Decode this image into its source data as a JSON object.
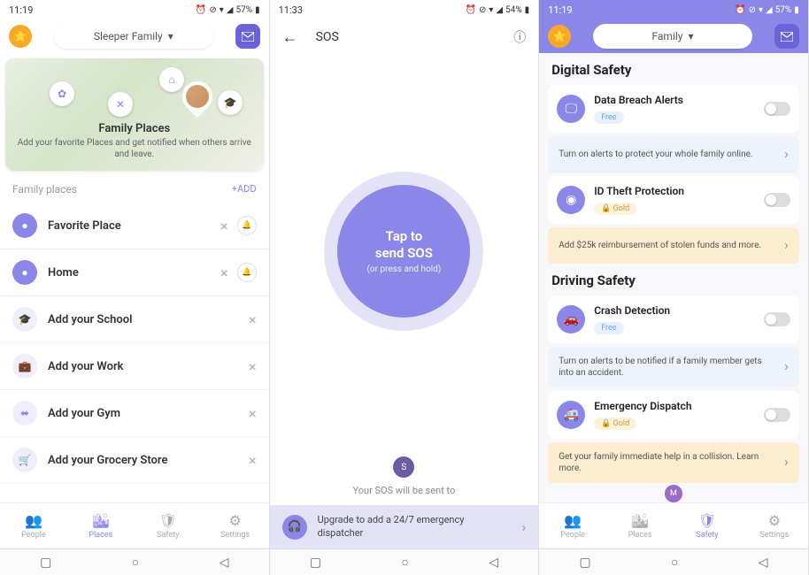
{
  "status": {
    "time1": "11:19",
    "time2": "11:33",
    "time3": "11:19",
    "battery1": "57%",
    "battery2": "54%",
    "battery3": "57%"
  },
  "screen1": {
    "family_selector": "Sleeper Family",
    "map": {
      "title": "Family Places",
      "subtitle": "Add your favorite Places and get notified when others arrive and leave."
    },
    "section": {
      "label": "Family places",
      "action": "+ADD"
    },
    "places": [
      {
        "icon": "pin",
        "label": "Favorite Place",
        "filled": true,
        "bell": true
      },
      {
        "icon": "pin",
        "label": "Home",
        "filled": true,
        "bell": true
      },
      {
        "icon": "school",
        "label": "Add your School",
        "filled": false,
        "bell": false
      },
      {
        "icon": "work",
        "label": "Add your Work",
        "filled": false,
        "bell": false
      },
      {
        "icon": "gym",
        "label": "Add your Gym",
        "filled": false,
        "bell": false
      },
      {
        "icon": "grocery",
        "label": "Add your Grocery Store",
        "filled": false,
        "bell": false
      }
    ],
    "nav": [
      {
        "label": "People"
      },
      {
        "label": "Places"
      },
      {
        "label": "Safety"
      },
      {
        "label": "Settings"
      }
    ]
  },
  "screen2": {
    "title": "SOS",
    "button_line1": "Tap to",
    "button_line2": "send SOS",
    "button_sub": "(or press and hold)",
    "avatar_letter": "S",
    "sent_to": "Your SOS will be sent to",
    "upgrade": "Upgrade to add a 24/7 emergency dispatcher"
  },
  "screen3": {
    "family_selector": "Family",
    "section1": "Digital Safety",
    "section2": "Driving Safety",
    "features": {
      "breach": {
        "title": "Data Breach Alerts",
        "badge": "Free"
      },
      "breach_banner": "Turn on alerts to protect your whole family online.",
      "theft": {
        "title": "ID Theft Protection",
        "badge": "Gold"
      },
      "theft_banner": "Add $25k reimbursement of stolen funds and more.",
      "crash": {
        "title": "Crash Detection",
        "badge": "Free"
      },
      "crash_banner": "Turn on alerts to be notified if a family member gets into an accident.",
      "dispatch": {
        "title": "Emergency Dispatch",
        "badge": "Gold"
      },
      "dispatch_banner": "Get your family immediate help in a collision. Learn more."
    },
    "m_letter": "M",
    "nav": [
      {
        "label": "People"
      },
      {
        "label": "Places"
      },
      {
        "label": "Safety"
      },
      {
        "label": "Settings"
      }
    ]
  }
}
